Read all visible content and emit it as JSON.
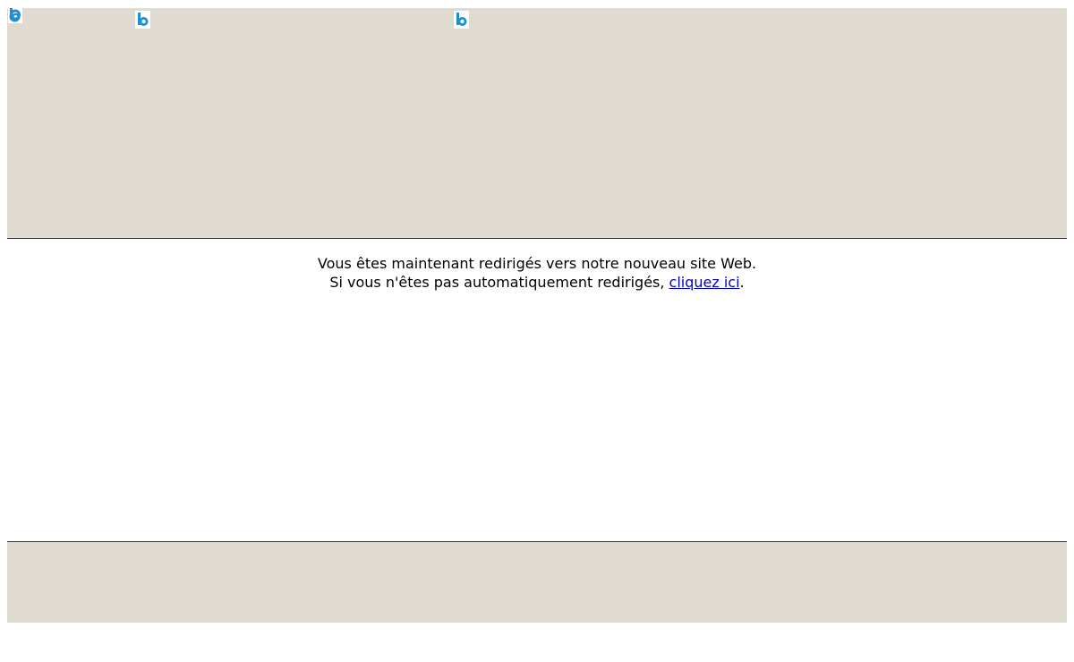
{
  "redirect": {
    "line1": "Vous êtes maintenant redirigés vers notre nouveau site Web.",
    "line2_prefix": "Si vous n'êtes pas automatiquement redirigés, ",
    "link_text": "cliquez ici",
    "line2_suffix": "."
  },
  "images": [
    {
      "icon": "broken-image-icon"
    },
    {
      "icon": "broken-image-icon"
    },
    {
      "icon": "broken-image-icon"
    }
  ],
  "colors": {
    "band": "#dfdbd0",
    "divider": "#333333",
    "link": "#0000cc",
    "icon_blue": "#1e8fd6"
  }
}
